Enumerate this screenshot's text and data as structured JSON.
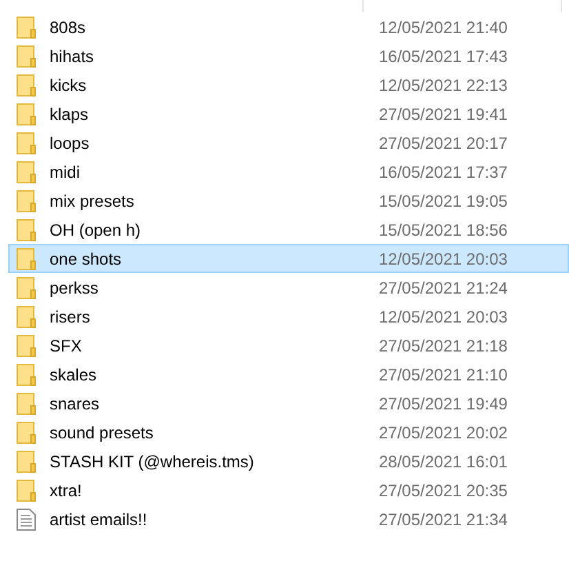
{
  "files": [
    {
      "kind": "folder",
      "name": "808s",
      "modified": "12/05/2021 21:40",
      "selected": false
    },
    {
      "kind": "folder",
      "name": "hihats",
      "modified": "16/05/2021 17:43",
      "selected": false
    },
    {
      "kind": "folder",
      "name": "kicks",
      "modified": "12/05/2021 22:13",
      "selected": false
    },
    {
      "kind": "folder",
      "name": "klaps",
      "modified": "27/05/2021 19:41",
      "selected": false
    },
    {
      "kind": "folder",
      "name": "loops",
      "modified": "27/05/2021 20:17",
      "selected": false
    },
    {
      "kind": "folder",
      "name": "midi",
      "modified": "16/05/2021 17:37",
      "selected": false
    },
    {
      "kind": "folder",
      "name": "mix presets",
      "modified": "15/05/2021 19:05",
      "selected": false
    },
    {
      "kind": "folder",
      "name": "OH (open h)",
      "modified": "15/05/2021 18:56",
      "selected": false
    },
    {
      "kind": "folder",
      "name": "one shots",
      "modified": "12/05/2021 20:03",
      "selected": true
    },
    {
      "kind": "folder",
      "name": "perkss",
      "modified": "27/05/2021 21:24",
      "selected": false
    },
    {
      "kind": "folder",
      "name": "risers",
      "modified": "12/05/2021 20:03",
      "selected": false
    },
    {
      "kind": "folder",
      "name": "SFX",
      "modified": "27/05/2021 21:18",
      "selected": false
    },
    {
      "kind": "folder",
      "name": "skales",
      "modified": "27/05/2021 21:10",
      "selected": false
    },
    {
      "kind": "folder",
      "name": "snares",
      "modified": "27/05/2021 19:49",
      "selected": false
    },
    {
      "kind": "folder",
      "name": "sound presets",
      "modified": "27/05/2021 20:02",
      "selected": false
    },
    {
      "kind": "folder",
      "name": "STASH KIT (@whereis.tms)",
      "modified": "28/05/2021 16:01",
      "selected": false
    },
    {
      "kind": "folder",
      "name": "xtra!",
      "modified": "27/05/2021 20:35",
      "selected": false
    },
    {
      "kind": "document",
      "name": "artist emails!!",
      "modified": "27/05/2021 21:34",
      "selected": false
    }
  ]
}
